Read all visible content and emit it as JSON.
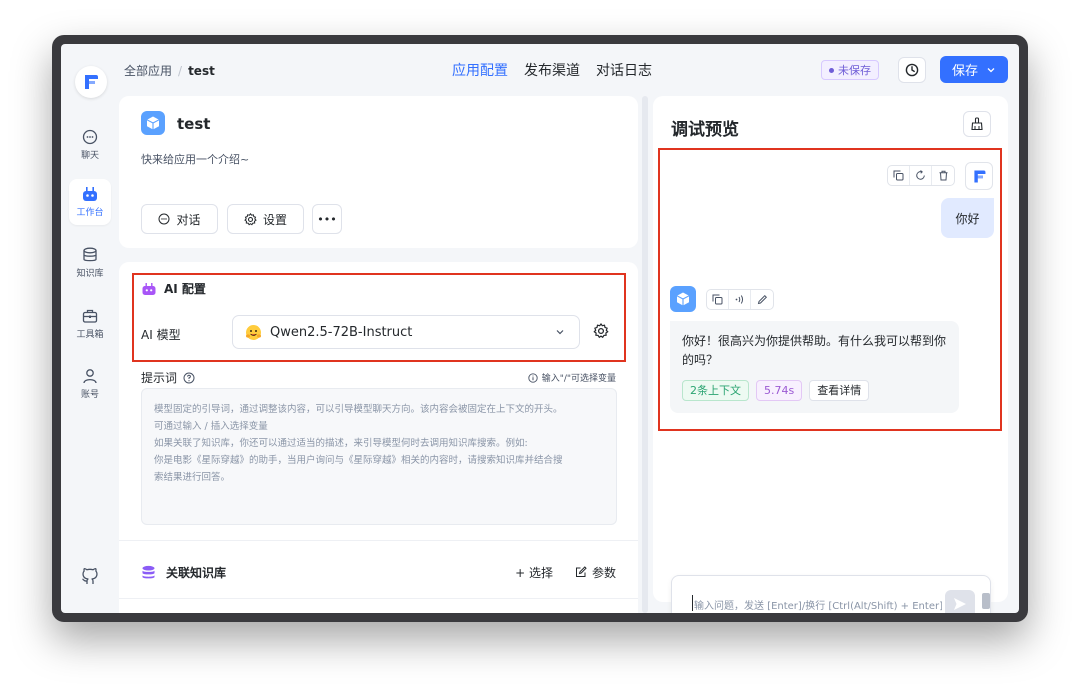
{
  "topbar": {
    "breadcrumb_root": "全部应用",
    "breadcrumb_sep": "/",
    "breadcrumb_current": "test",
    "tabs": [
      {
        "label": "应用配置",
        "active": true
      },
      {
        "label": "发布渠道",
        "active": false
      },
      {
        "label": "对话日志",
        "active": false
      }
    ],
    "unsaved_badge": "未保存",
    "save_label": "保存",
    "accent_color": "#3370ff"
  },
  "sidebar": {
    "items": [
      {
        "label": "聊天",
        "icon": "chat-icon",
        "active": false
      },
      {
        "label": "工作台",
        "icon": "robot-icon",
        "active": true
      },
      {
        "label": "知识库",
        "icon": "database-icon",
        "active": false
      },
      {
        "label": "工具箱",
        "icon": "toolbox-icon",
        "active": false
      },
      {
        "label": "账号",
        "icon": "user-icon",
        "active": false
      }
    ],
    "footer_icon": "github-icon"
  },
  "app_info": {
    "name": "test",
    "description": "快来给应用一个介绍~",
    "chat_button": "对话",
    "settings_button": "设置",
    "more_button": "•••"
  },
  "ai_config": {
    "title": "AI 配置",
    "model_label": "AI 模型",
    "model_value": "Qwen2.5-72B-Instruct",
    "prompt_label": "提示词",
    "prompt_hint": "输入\"/\"可选择变量",
    "prompt_placeholder_lines": [
      "模型固定的引导词，通过调整该内容，可以引导模型聊天方向。该内容会被固定在上下文的开头。",
      "可通过输入 / 插入选择变量",
      "如果关联了知识库，你还可以通过适当的描述，来引导模型何时去调用知识库搜索。例如:",
      "你是电影《星际穿越》的助手，当用户询问与《星际穿越》相关的内容时，请搜索知识库并结合搜",
      "索结果进行回答。"
    ],
    "knowledge_title": "关联知识库",
    "knowledge_select": "+ 选择",
    "knowledge_params": "参数"
  },
  "preview": {
    "title": "调试预览",
    "user_message": "你好",
    "bot_message": "你好！很高兴为你提供帮助。有什么我可以帮到你的吗？",
    "tag_context": "2条上下文",
    "tag_time": "5.74s",
    "tag_detail": "查看详情",
    "input_placeholder": "输入问题，发送 [Enter]/换行 [Ctrl(Alt/Shift) + Enter]"
  }
}
